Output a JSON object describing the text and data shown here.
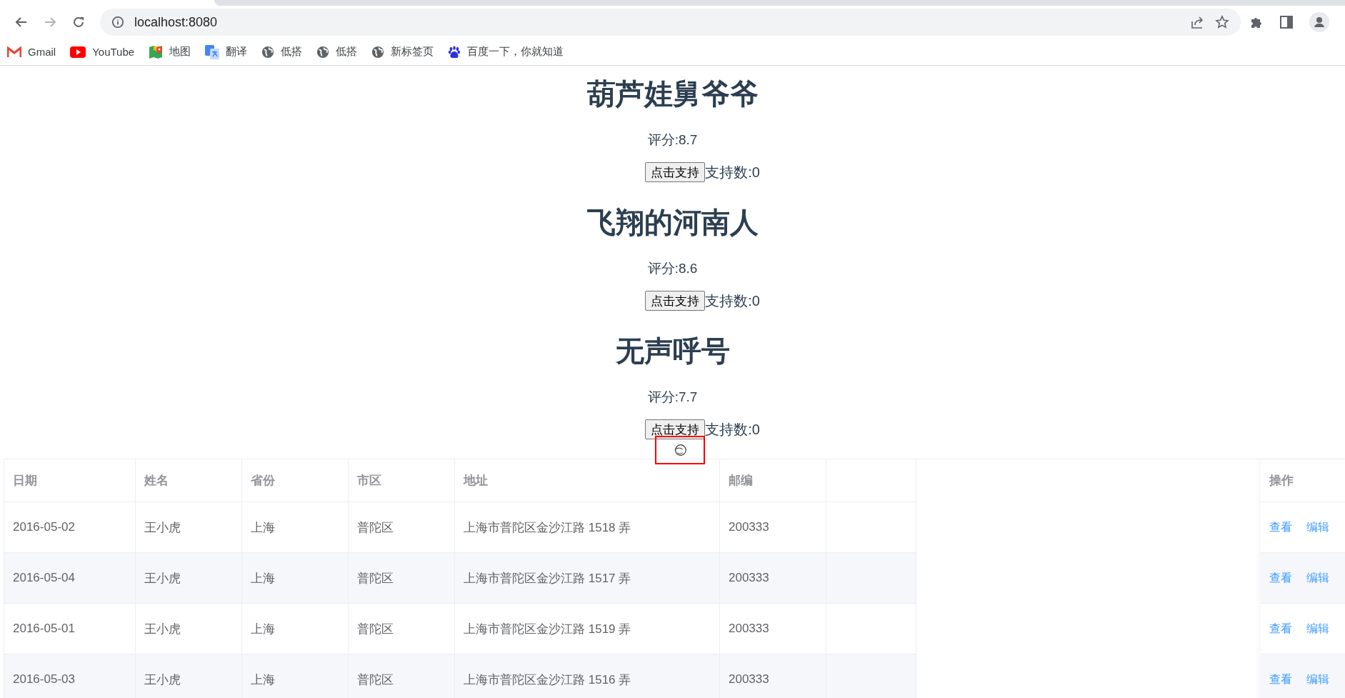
{
  "browser": {
    "nav_buttons": [
      {
        "kind": "back",
        "disabled": false
      },
      {
        "kind": "forward",
        "disabled": true
      },
      {
        "kind": "reload",
        "disabled": false
      }
    ],
    "address": "localhost:8080",
    "bookmarks": [
      {
        "kind": "mail",
        "label": "Gmail"
      },
      {
        "kind": "video",
        "label": "YouTube"
      },
      {
        "kind": "map",
        "label": "地图"
      },
      {
        "kind": "translate",
        "label": "翻译"
      },
      {
        "kind": "globe",
        "label": "低搭"
      },
      {
        "kind": "globe",
        "label": "低搭"
      },
      {
        "kind": "globe",
        "label": "新标签页"
      },
      {
        "kind": "paw",
        "label": "百度一下，你就知道"
      }
    ]
  },
  "movies": [
    {
      "title": "葫芦娃舅爷爷",
      "rating": "评分:8.7",
      "button": "点击支持",
      "support": "支持数:0"
    },
    {
      "title": "飞翔的河南人",
      "rating": "评分:8.6",
      "button": "点击支持",
      "support": "支持数:0"
    },
    {
      "title": "无声呼号",
      "rating": "评分:7.7",
      "button": "点击支持",
      "support": "支持数:0"
    }
  ],
  "table": {
    "columns": [
      "日期",
      "姓名",
      "省份",
      "市区",
      "地址",
      "邮编"
    ],
    "action_column": "操作",
    "rows": [
      {
        "cells": [
          "2016-05-02",
          "王小虎",
          "上海",
          "普陀区",
          "上海市普陀区金沙江路 1518 弄",
          "200333"
        ],
        "actions": [
          "查看",
          "编辑"
        ]
      },
      {
        "cells": [
          "2016-05-04",
          "王小虎",
          "上海",
          "普陀区",
          "上海市普陀区金沙江路 1517 弄",
          "200333"
        ],
        "actions": [
          "查看",
          "编辑"
        ]
      },
      {
        "cells": [
          "2016-05-01",
          "王小虎",
          "上海",
          "普陀区",
          "上海市普陀区金沙江路 1519 弄",
          "200333"
        ],
        "actions": [
          "查看",
          "编辑"
        ]
      },
      {
        "cells": [
          "2016-05-03",
          "王小虎",
          "上海",
          "普陀区",
          "上海市普陀区金沙江路 1516 弄",
          "200333"
        ],
        "actions": [
          "查看",
          "编辑"
        ]
      }
    ]
  }
}
